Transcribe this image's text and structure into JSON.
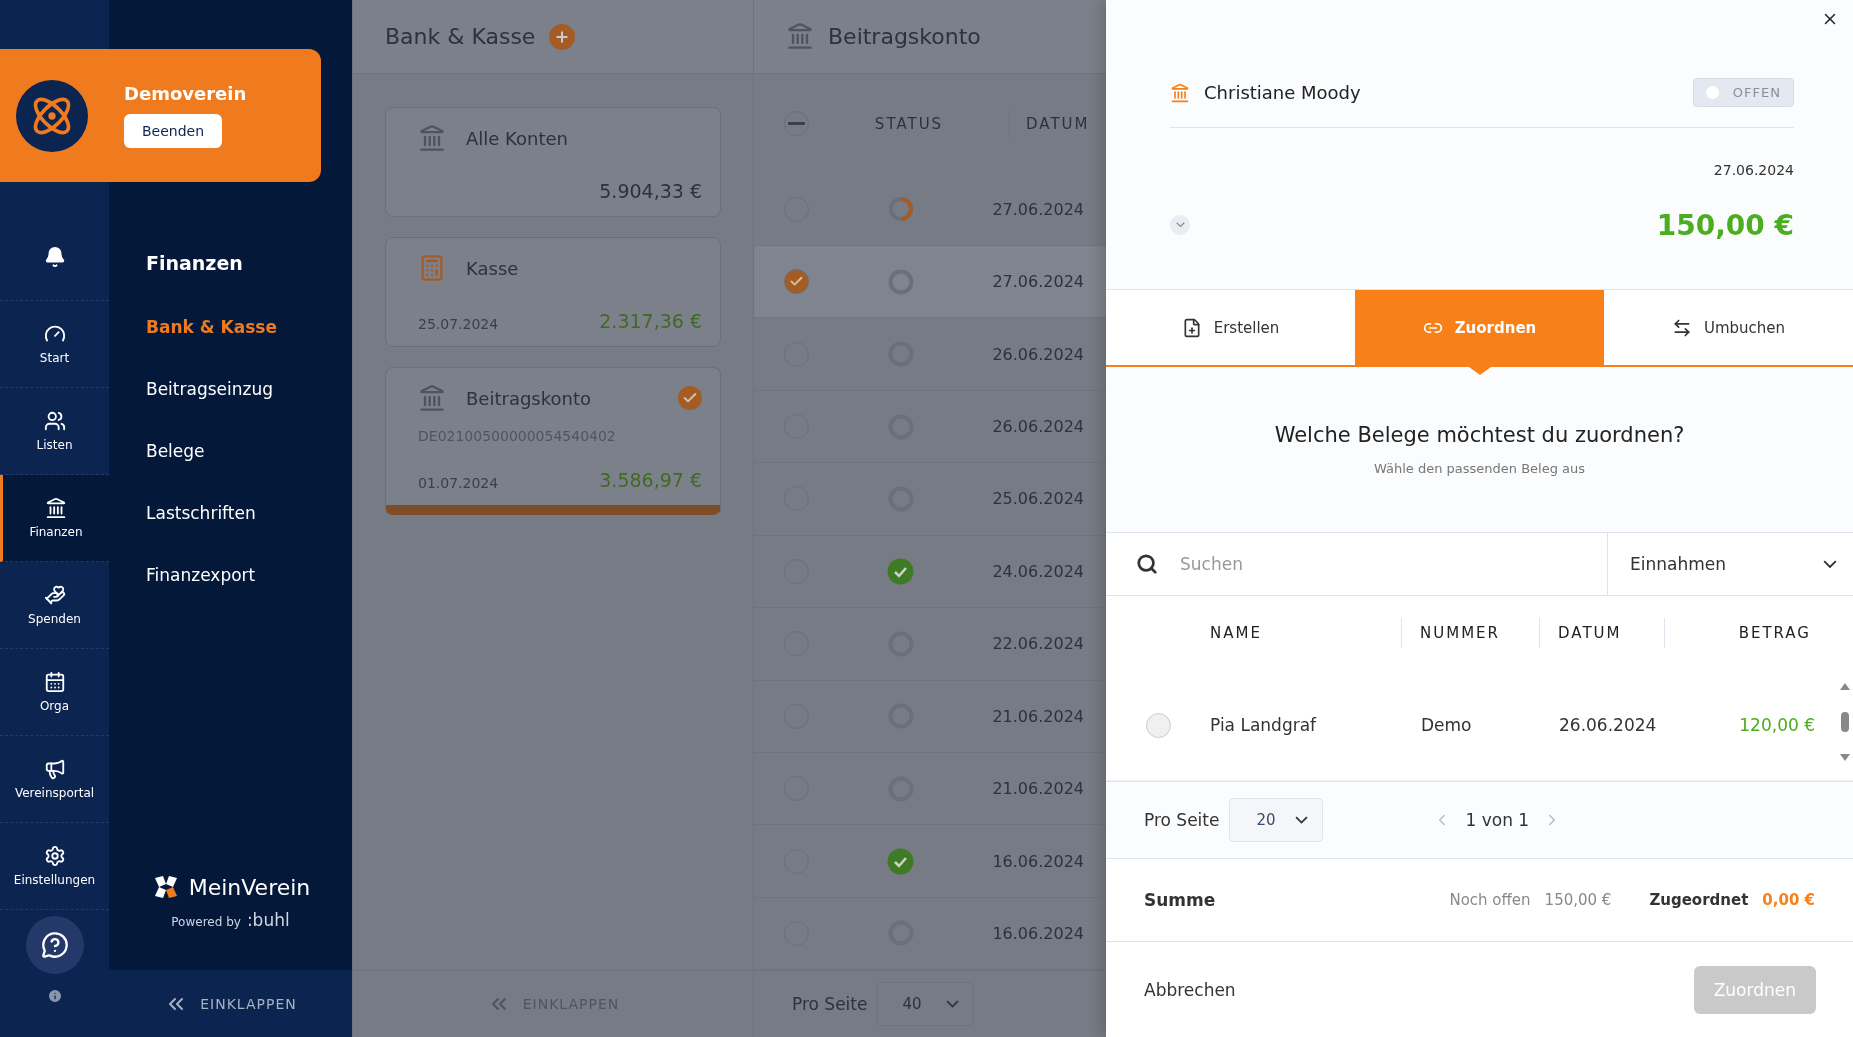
{
  "org": {
    "name": "Demoverein",
    "button": "Beenden"
  },
  "rail": [
    {
      "selected": false
    },
    {
      "label": "Start",
      "selected": false
    },
    {
      "label": "Listen",
      "selected": false
    },
    {
      "label": "Finanzen",
      "selected": true
    },
    {
      "label": "Spenden",
      "selected": false
    },
    {
      "label": "Orga",
      "selected": false
    },
    {
      "label": "Vereinsportal",
      "selected": false
    },
    {
      "label": "Einstellungen",
      "selected": false
    }
  ],
  "nav": {
    "title": "Finanzen",
    "items": [
      {
        "label": "Bank & Kasse",
        "selected": true
      },
      {
        "label": "Beitragseinzug",
        "selected": false
      },
      {
        "label": "Belege",
        "selected": false
      },
      {
        "label": "Lastschriften",
        "selected": false
      },
      {
        "label": "Finanzexport",
        "selected": false
      }
    ],
    "brand": "MeinVerein",
    "powered": "Powered by",
    "powered_brand": ":buhl",
    "collapse": "EINKLAPPEN"
  },
  "accounts": {
    "title": "Bank & Kasse",
    "collapse": "EINKLAPPEN",
    "items": [
      {
        "kind": "bank",
        "name": "Alle Konten",
        "amount": "5.904,33 €",
        "positive": false,
        "selected": false
      },
      {
        "kind": "cash",
        "name": "Kasse",
        "date": "25.07.2024",
        "amount": "2.317,36 €",
        "positive": true,
        "selected": false
      },
      {
        "kind": "bank",
        "name": "Beitragskonto",
        "iban": "DE02100500000054540402",
        "date": "01.07.2024",
        "amount": "3.586,97 €",
        "positive": true,
        "selected": true
      }
    ]
  },
  "transactions": {
    "title": "Beitragskonto",
    "select_all_partial": true,
    "columns": [
      "STATUS",
      "DATUM"
    ],
    "per_page_label": "Pro Seite",
    "per_page": "40",
    "rows": [
      {
        "kind": "partial",
        "checked": false,
        "date": "27.06.2024"
      },
      {
        "kind": "open",
        "checked": true,
        "date": "27.06.2024"
      },
      {
        "kind": "open",
        "checked": false,
        "date": "26.06.2024"
      },
      {
        "kind": "open",
        "checked": false,
        "date": "26.06.2024"
      },
      {
        "kind": "open",
        "checked": false,
        "date": "25.06.2024"
      },
      {
        "kind": "done",
        "checked": false,
        "date": "24.06.2024"
      },
      {
        "kind": "open",
        "checked": false,
        "date": "22.06.2024"
      },
      {
        "kind": "open",
        "checked": false,
        "date": "21.06.2024"
      },
      {
        "kind": "open",
        "checked": false,
        "date": "21.06.2024"
      },
      {
        "kind": "done",
        "checked": false,
        "date": "16.06.2024"
      },
      {
        "kind": "open",
        "checked": false,
        "date": "16.06.2024"
      }
    ]
  },
  "drawer": {
    "name": "Christiane Moody",
    "status": "OFFEN",
    "date": "27.06.2024",
    "amount": "150,00 €",
    "tabs": [
      {
        "kind": "create",
        "label": "Erstellen",
        "selected": false
      },
      {
        "kind": "assign",
        "label": "Zuordnen",
        "selected": true
      },
      {
        "kind": "transfer",
        "label": "Umbuchen",
        "selected": false
      }
    ],
    "heading": "Welche Belege möchtest du zuordnen?",
    "subheading": "Wähle den passenden Beleg aus",
    "search": {
      "placeholder": "Suchen"
    },
    "filter": "Einnahmen",
    "columns": [
      "NAME",
      "NUMMER",
      "DATUM",
      "BETRAG"
    ],
    "rows": [
      {
        "selected": false,
        "name": "Pia Landgraf",
        "number": "Demo",
        "date": "26.06.2024",
        "amount": "120,00 €"
      }
    ],
    "per_page_label": "Pro Seite",
    "per_page": "20",
    "page": "1 von 1",
    "sum_label": "Summe",
    "open_label": "Noch offen",
    "open_amount": "150,00 €",
    "assigned_label": "Zugeordnet",
    "assigned_amount": "0,00 €",
    "cancel": "Abbrechen",
    "submit": "Zuordnen",
    "submit_disabled": true
  }
}
